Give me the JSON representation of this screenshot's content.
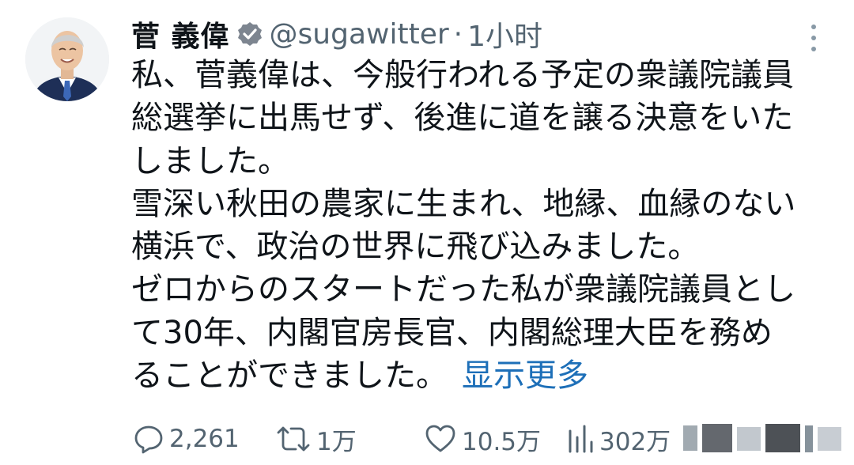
{
  "tweet": {
    "author": {
      "display_name": "菅 義偉",
      "handle": "@sugawitter",
      "verified": true
    },
    "separator": "·",
    "time": "1小时",
    "lines": [
      "私、菅義偉は、今般行われる予定の衆議院議員",
      "総選挙に出馬せず、後進に道を譲る決意をいた",
      "しました。",
      "雪深い秋田の農家に生まれ、地縁、血縁のない",
      "横浜で、政治の世界に飛び込みました。",
      "ゼロからのスタートだった私が衆議院議員とし",
      "て30年、内閣官房長官、内閣総理大臣を務め",
      "ることができました。"
    ],
    "show_more_label": "显示更多",
    "stats": {
      "replies": "2,261",
      "retweets": "1万",
      "likes": "10.5万",
      "views": "302万"
    }
  },
  "icons": {
    "verified": "verified-badge-icon",
    "more": "more-vertical-icon",
    "reply": "reply-icon",
    "retweet": "retweet-icon",
    "like": "like-icon",
    "views": "views-icon"
  },
  "colors": {
    "text": "#0f1419",
    "secondary": "#536471",
    "link": "#1d6fb8"
  }
}
